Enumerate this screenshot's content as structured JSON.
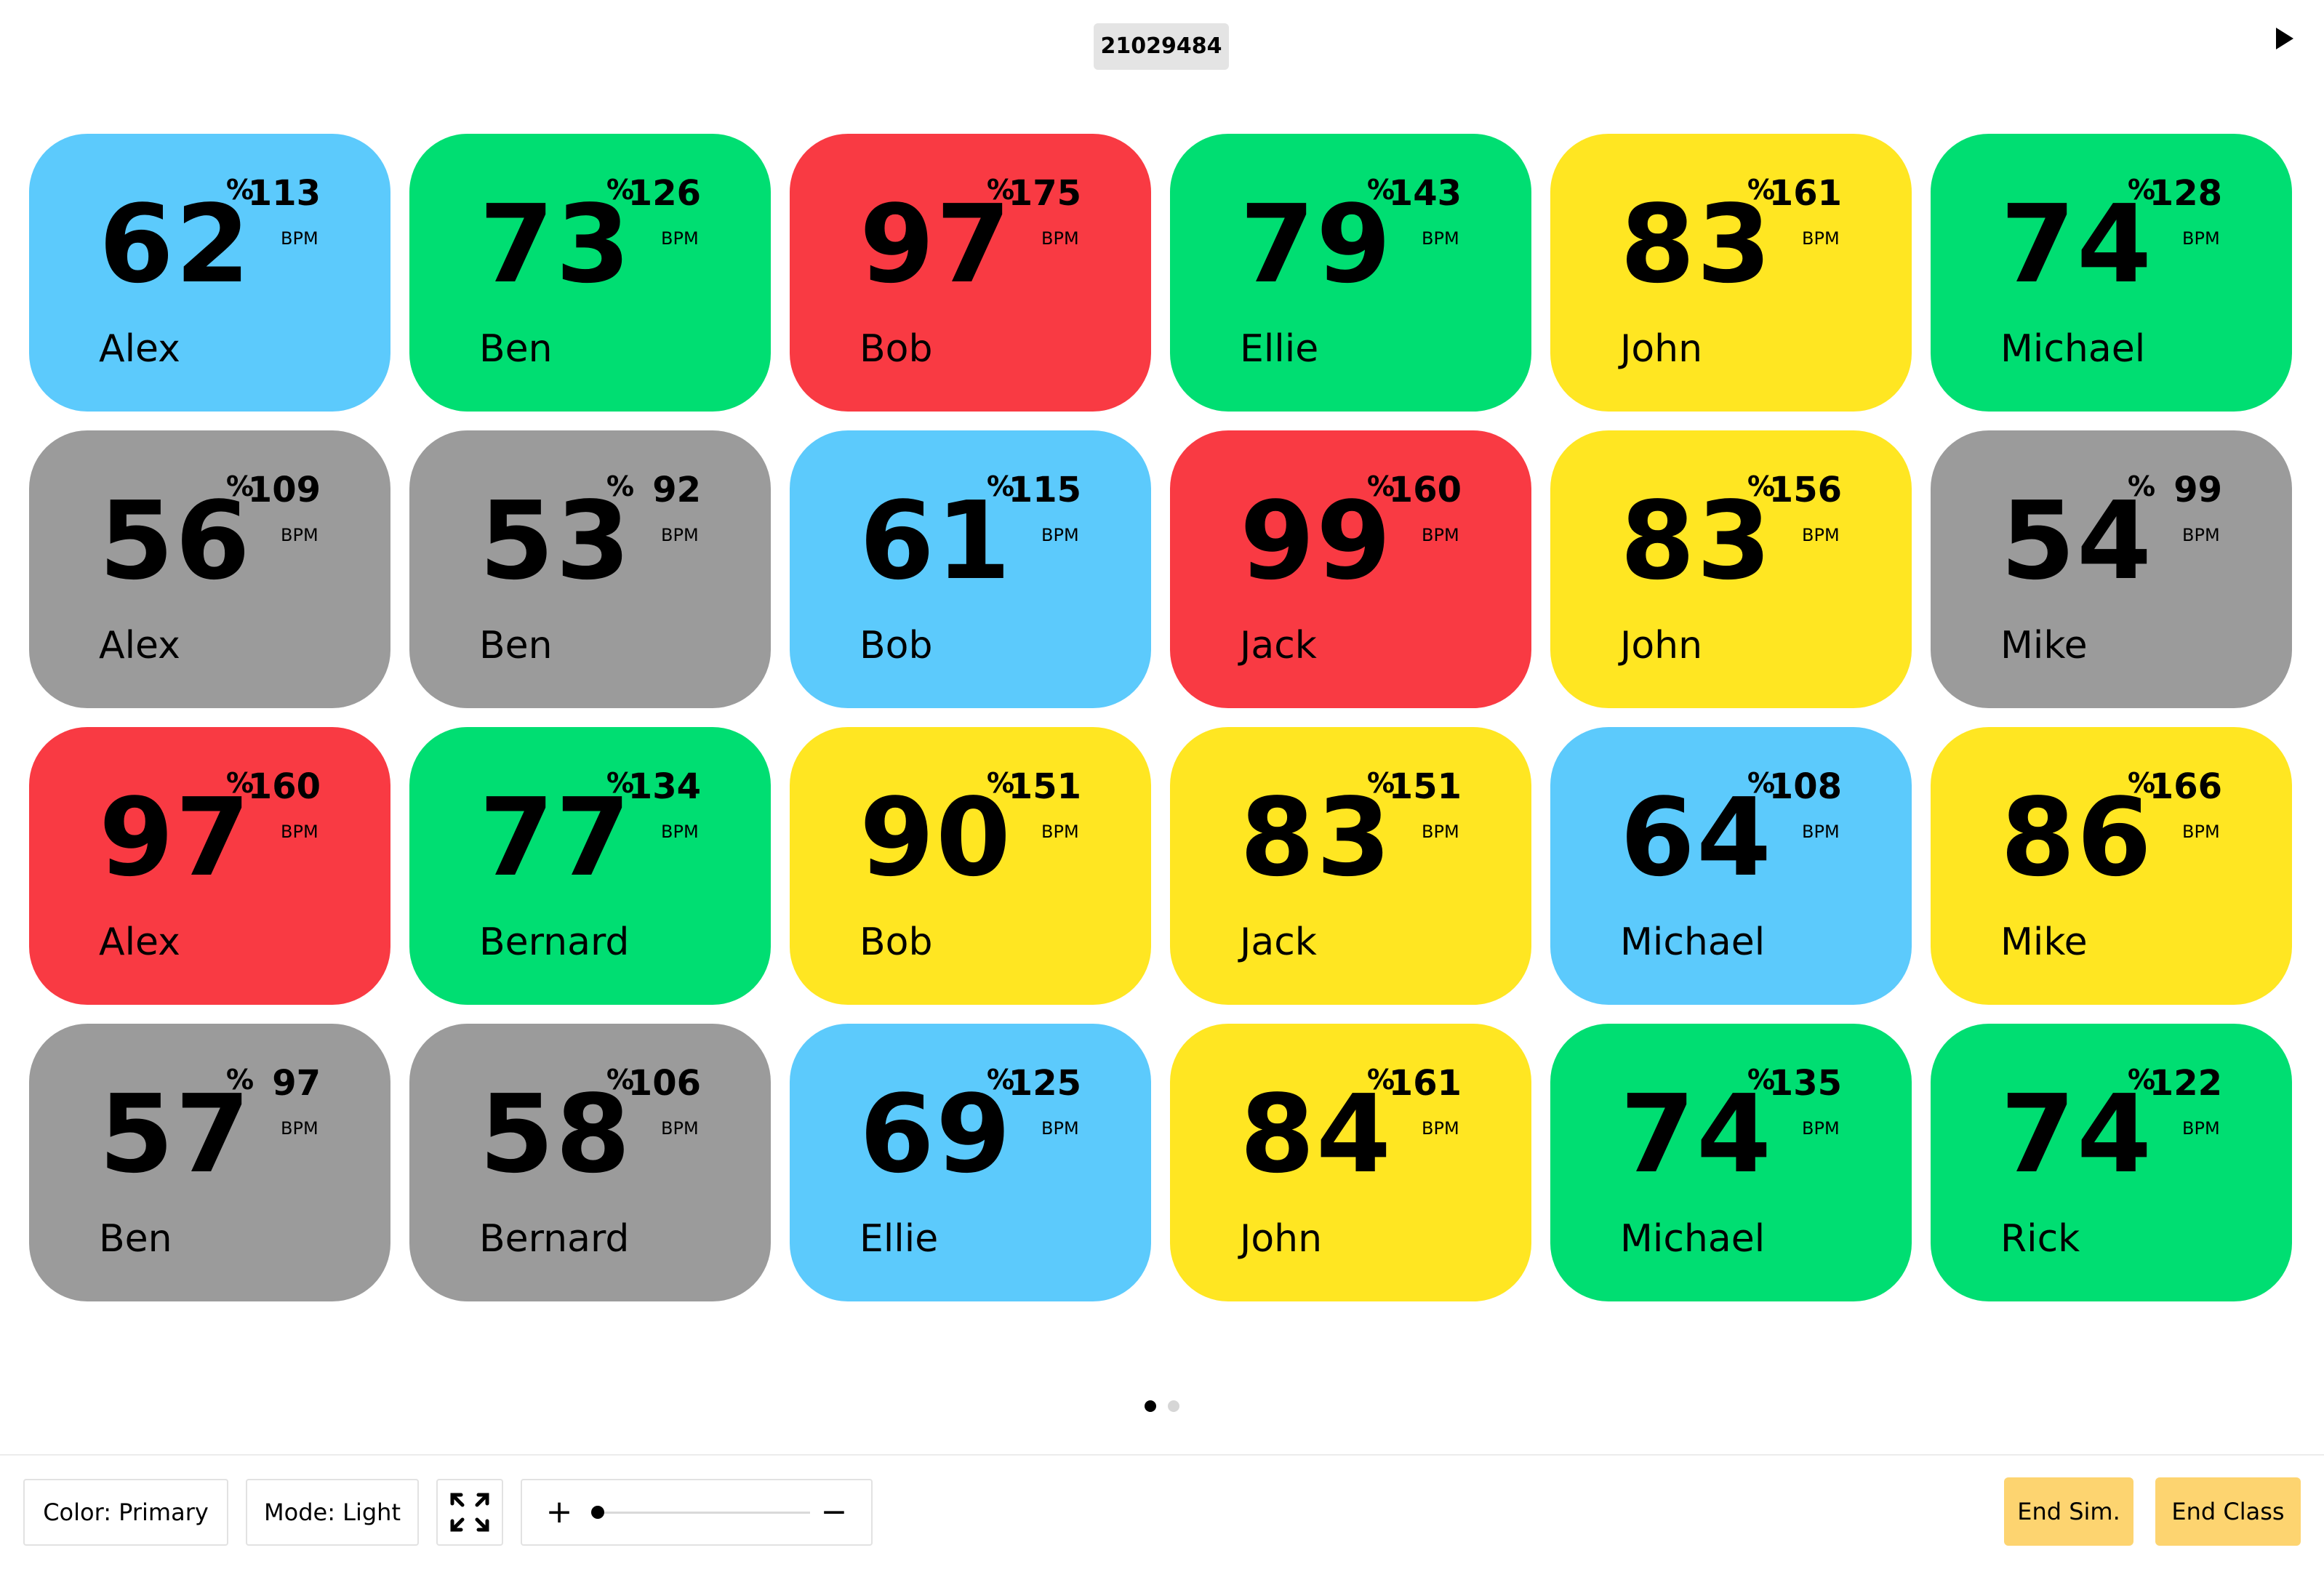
{
  "header": {
    "class_code": "21029484"
  },
  "tiles": [
    {
      "percent": "62",
      "bpm": "113",
      "name": "Alex",
      "zone": "blue"
    },
    {
      "percent": "73",
      "bpm": "126",
      "name": "Ben",
      "zone": "green"
    },
    {
      "percent": "97",
      "bpm": "175",
      "name": "Bob",
      "zone": "red"
    },
    {
      "percent": "79",
      "bpm": "143",
      "name": "Ellie",
      "zone": "green"
    },
    {
      "percent": "83",
      "bpm": "161",
      "name": "John",
      "zone": "yellow"
    },
    {
      "percent": "74",
      "bpm": "128",
      "name": "Michael",
      "zone": "green"
    },
    {
      "percent": "56",
      "bpm": "109",
      "name": "Alex",
      "zone": "grey"
    },
    {
      "percent": "53",
      "bpm": "92",
      "name": "Ben",
      "zone": "grey"
    },
    {
      "percent": "61",
      "bpm": "115",
      "name": "Bob",
      "zone": "blue"
    },
    {
      "percent": "99",
      "bpm": "160",
      "name": "Jack",
      "zone": "red"
    },
    {
      "percent": "83",
      "bpm": "156",
      "name": "John",
      "zone": "yellow"
    },
    {
      "percent": "54",
      "bpm": "99",
      "name": "Mike",
      "zone": "grey"
    },
    {
      "percent": "97",
      "bpm": "160",
      "name": "Alex",
      "zone": "red"
    },
    {
      "percent": "77",
      "bpm": "134",
      "name": "Bernard",
      "zone": "green"
    },
    {
      "percent": "90",
      "bpm": "151",
      "name": "Bob",
      "zone": "yellow"
    },
    {
      "percent": "83",
      "bpm": "151",
      "name": "Jack",
      "zone": "yellow"
    },
    {
      "percent": "64",
      "bpm": "108",
      "name": "Michael",
      "zone": "blue"
    },
    {
      "percent": "86",
      "bpm": "166",
      "name": "Mike",
      "zone": "yellow"
    },
    {
      "percent": "57",
      "bpm": "97",
      "name": "Ben",
      "zone": "grey"
    },
    {
      "percent": "58",
      "bpm": "106",
      "name": "Bernard",
      "zone": "grey"
    },
    {
      "percent": "69",
      "bpm": "125",
      "name": "Ellie",
      "zone": "blue"
    },
    {
      "percent": "84",
      "bpm": "161",
      "name": "John",
      "zone": "yellow"
    },
    {
      "percent": "74",
      "bpm": "135",
      "name": "Michael",
      "zone": "green"
    },
    {
      "percent": "74",
      "bpm": "122",
      "name": "Rick",
      "zone": "green"
    }
  ],
  "tile_labels": {
    "percent_sign": "%",
    "bpm_unit": "BPM"
  },
  "zone_colors": {
    "blue": "#5ccafc",
    "green": "#00de72",
    "red": "#f93a43",
    "yellow": "#ffe622",
    "grey": "#9b9b9b"
  },
  "pager": {
    "page_count": 2,
    "current_page": 1
  },
  "toolbar": {
    "color_label": "Color: Primary",
    "mode_label": "Mode: Light",
    "zoom_plus": "+",
    "zoom_minus": "−",
    "zoom_level": 0.0,
    "end_sim_label": "End Sim.",
    "end_class_label": "End Class",
    "end_button_color": "#fdd470"
  },
  "icons": [
    "play-icon",
    "fullscreen-icon"
  ]
}
